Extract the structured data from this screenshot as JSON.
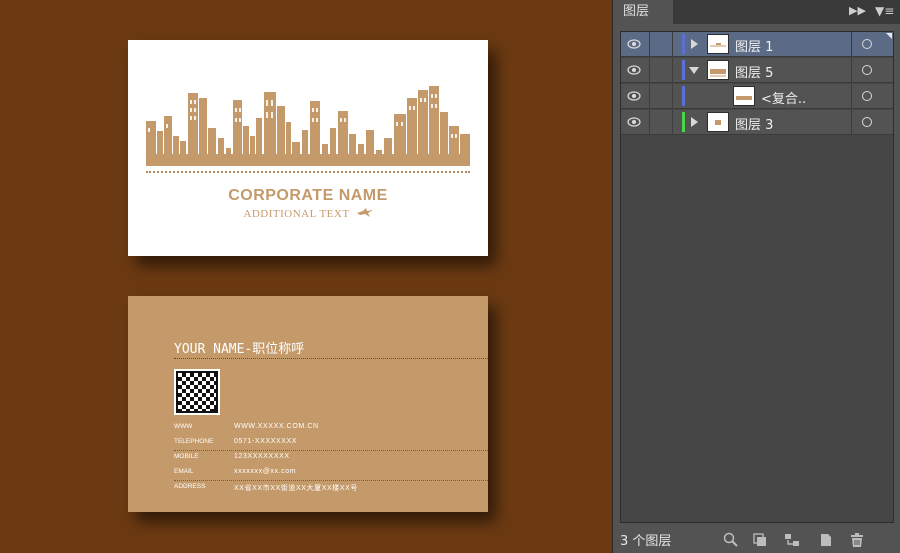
{
  "card_front": {
    "corporate_name": "CORPORATE NAME",
    "additional_text": "ADDITIONAL TEXT"
  },
  "card_back": {
    "your_name": "YOUR NAME-职位称呼",
    "info": [
      {
        "label": "WWW",
        "value": "WWW.XXXXX.COM.CN"
      },
      {
        "label": "TELEPHONE",
        "value": "0571-XXXXXXXX"
      },
      {
        "label": "MOBILE",
        "value": "123XXXXXXXX"
      },
      {
        "label": "EMAIL",
        "value": "xxxxxxx@xx.com"
      },
      {
        "label": "ADDRESS",
        "value": "XX省XX市XX街道XX大厦XX楼XX号"
      }
    ]
  },
  "panel": {
    "title": "图层",
    "layers": [
      {
        "name": "图层 1",
        "color": "#5a6fd8",
        "expanded": false,
        "selected": true
      },
      {
        "name": "图层 5",
        "color": "#5a6fd8",
        "expanded": true,
        "selected": false
      },
      {
        "name": "<复合..",
        "color": "#5a6fd8",
        "expanded": false,
        "selected": false
      },
      {
        "name": "图层 3",
        "color": "#4cd64c",
        "expanded": false,
        "selected": false
      }
    ],
    "footer_count": "3 个图层",
    "icons": [
      "expand-arrows-icon",
      "panel-menu-icon",
      "eye-icon",
      "target-circle-icon",
      "search-icon",
      "clipping-mask-icon",
      "sublayer-icon",
      "new-layer-icon",
      "trash-icon"
    ]
  },
  "colors": {
    "background": "#6b3a12",
    "card_tan": "#c49a6a",
    "panel_bg": "#535353",
    "selected_row": "#5b6b86"
  }
}
